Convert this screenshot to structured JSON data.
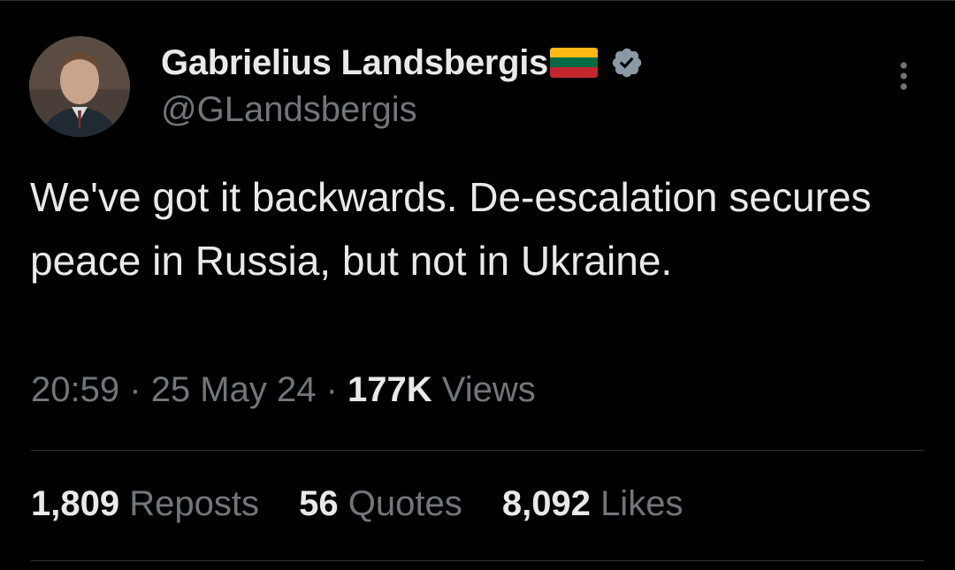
{
  "author": {
    "display_name": "Gabrielius Landsbergis",
    "handle": "@GLandsbergis",
    "flag_icon": "lithuania-flag-icon",
    "verified_icon": "verified-badge-icon",
    "verified_color": "#1d9bf0"
  },
  "tweet": {
    "text": "We've got it backwards. De-escalation secures peace in Russia, but not in Ukraine.",
    "time": "20:59",
    "date": "25 May 24",
    "separator": "·",
    "views_count": "177K",
    "views_label": "Views"
  },
  "stats": {
    "reposts_count": "1,809",
    "reposts_label": "Reposts",
    "quotes_count": "56",
    "quotes_label": "Quotes",
    "likes_count": "8,092",
    "likes_label": "Likes"
  },
  "colors": {
    "background": "#000000",
    "primary_text": "#e7e9ea",
    "secondary_text": "#71767b",
    "divider": "#2f3336"
  },
  "icons": {
    "more": "more-options-icon",
    "avatar": "profile-avatar"
  }
}
